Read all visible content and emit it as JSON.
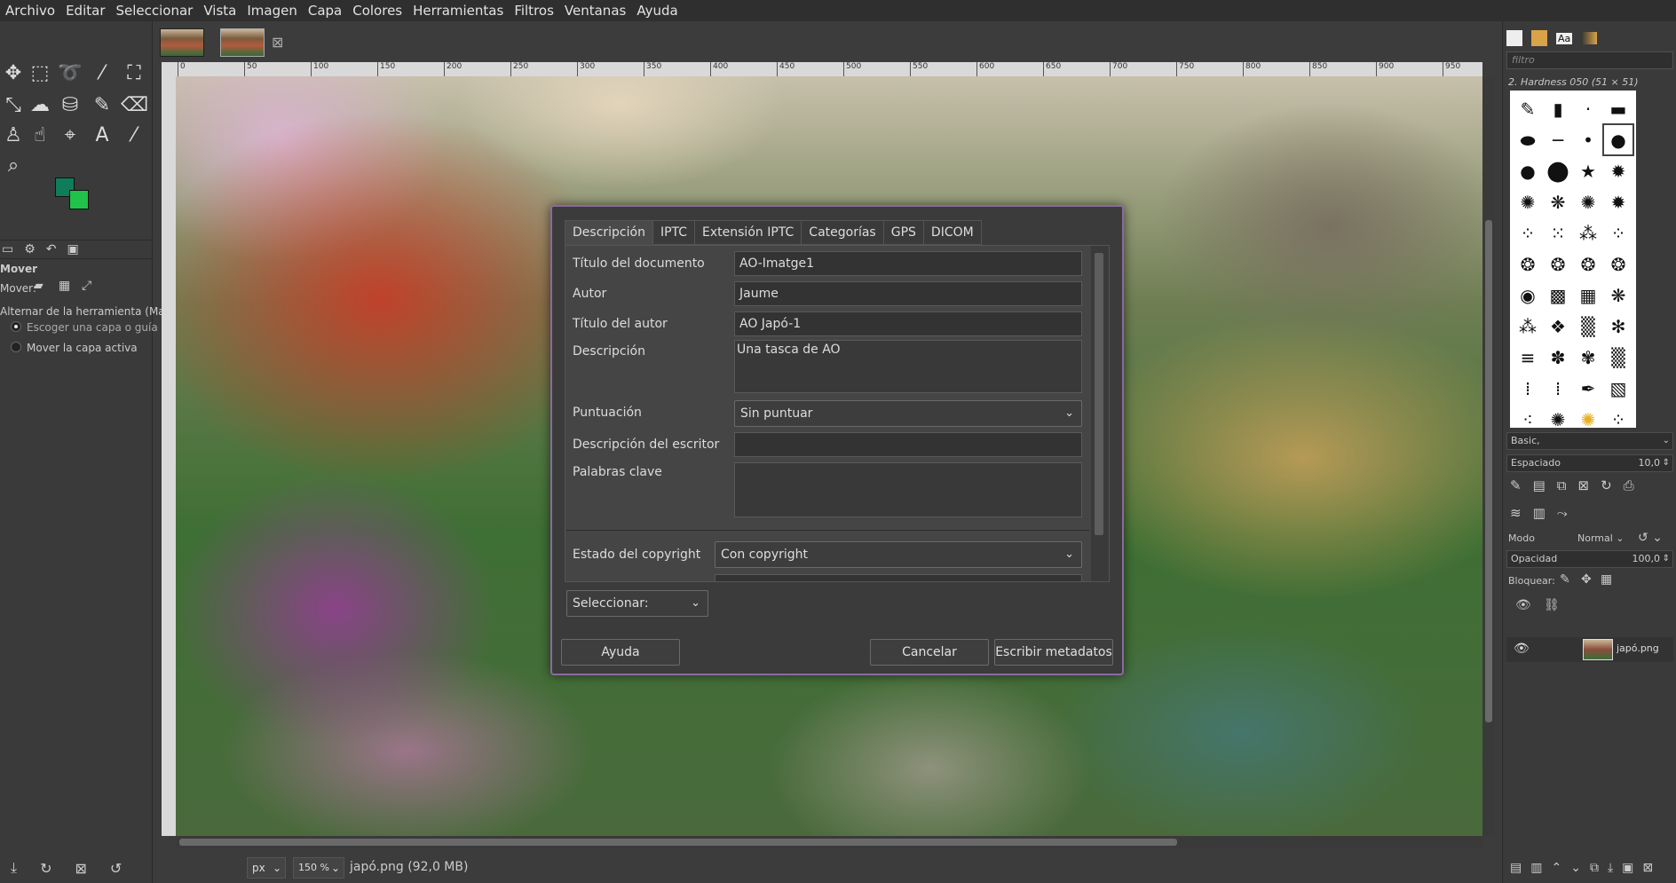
{
  "menubar": {
    "items": [
      "Archivo",
      "Editar",
      "Seleccionar",
      "Vista",
      "Imagen",
      "Capa",
      "Colores",
      "Herramientas",
      "Filtros",
      "Ventanas",
      "Ayuda"
    ]
  },
  "toolbox": {
    "tool_options_title": "Mover",
    "move_label": "Mover:",
    "toggle_label": "Alternar de la herramienta (Mayú",
    "option_pick": "Escoger una capa o guía",
    "option_move_active": "Mover la capa activa"
  },
  "ruler": {
    "ticks": [
      "0",
      "50",
      "100",
      "150",
      "200",
      "250",
      "300",
      "350",
      "400",
      "450",
      "500",
      "550",
      "600",
      "650",
      "700",
      "750",
      "800",
      "850",
      "900",
      "950"
    ]
  },
  "statusbar": {
    "unit": "px",
    "zoom": "150 %",
    "file_info": "japó.png (92,0 MB)"
  },
  "rightpanel": {
    "filter_placeholder": "filtro",
    "brush_name": "2. Hardness 050 (51 × 51)",
    "brush_category": "Basic,",
    "spacing_label": "Espaciado",
    "spacing_value": "10,0",
    "mode_label": "Modo",
    "mode_value": "Normal",
    "opacity_label": "Opacidad",
    "opacity_value": "100,0",
    "lock_label": "Bloquear:",
    "layer_name": "japó.png"
  },
  "dialog": {
    "tabs": [
      "Descripción",
      "IPTC",
      "Extensión IPTC",
      "Categorías",
      "GPS",
      "DICOM"
    ],
    "fields": {
      "doc_title_label": "Título del documento",
      "doc_title_value": "AO-Imatge1",
      "author_label": "Autor",
      "author_value": "Jaume",
      "author_title_label": "Título del autor",
      "author_title_value": "AO Japó-1",
      "description_label": "Descripción",
      "description_value": "Una tasca de AO",
      "rating_label": "Puntuación",
      "rating_value": "Sin puntuar",
      "writer_desc_label": "Descripción del escritor",
      "writer_desc_value": "",
      "keywords_label": "Palabras clave",
      "keywords_value": "",
      "copyright_label": "Estado del copyright",
      "copyright_value": "Con copyright"
    },
    "select_label": "Seleccionar:",
    "help_button": "Ayuda",
    "cancel_button": "Cancelar",
    "write_button": "Escribir metadatos"
  }
}
